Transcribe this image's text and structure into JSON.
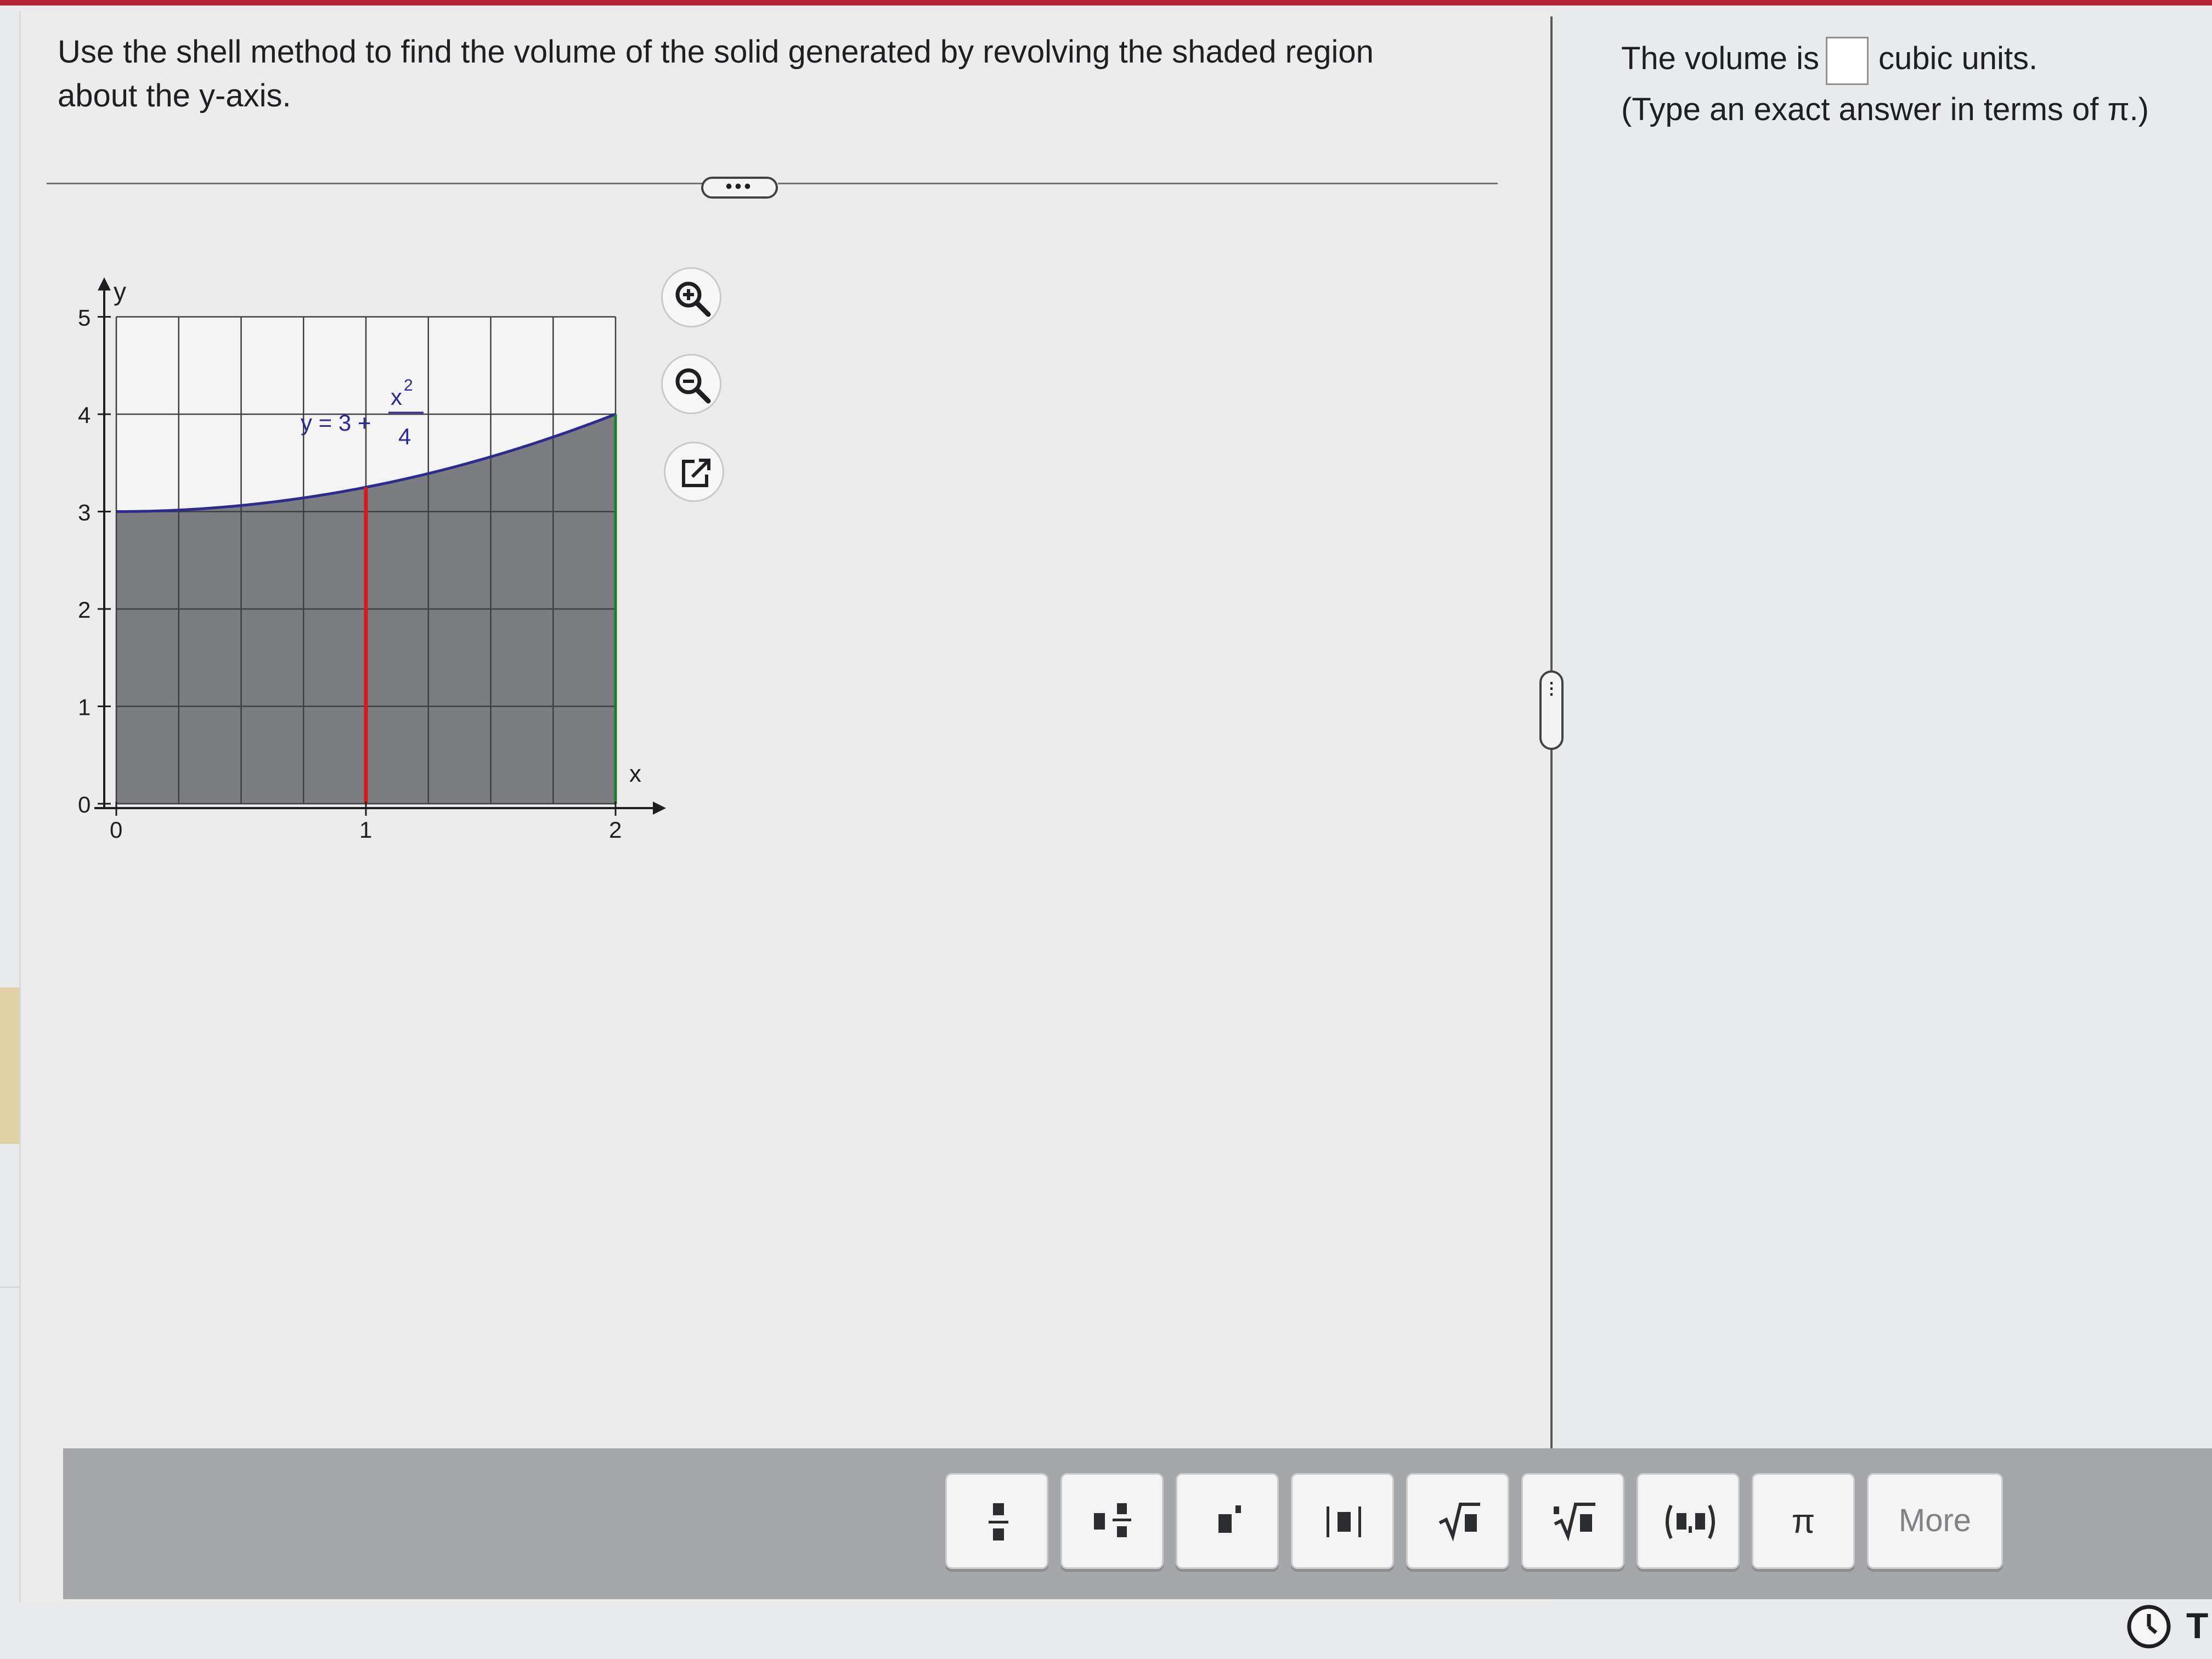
{
  "question": {
    "line1": "Use the shell method to find the volume of the solid generated by revolving the shaded region",
    "line2": "about the y-axis."
  },
  "graph": {
    "y_axis_label": "y",
    "x_axis_label": "x",
    "y_ticks": [
      "5",
      "4",
      "3",
      "2",
      "1",
      "0"
    ],
    "x_ticks": [
      "0",
      "1",
      "2"
    ],
    "curve_label_left": "y = 3 +",
    "curve_label_num": "x",
    "curve_label_exp": "2",
    "curve_label_den": "4",
    "xlim": [
      0,
      2
    ],
    "ylim": [
      0,
      5
    ],
    "curve": "y = 3 + x^2/4",
    "shell_x": 1,
    "colors": {
      "curve": "#2e2a8f",
      "shaded": "#7c7d80",
      "shell": "#d41a1a",
      "right_edge": "#1a7f2a"
    }
  },
  "tools": {
    "zoom_in": "zoom-in-icon",
    "zoom_out": "zoom-out-icon",
    "popout": "external-link-icon"
  },
  "answer": {
    "prefix": "The volume is",
    "suffix": "cubic units.",
    "hint": "(Type an exact answer in terms of π.)",
    "value": ""
  },
  "toolbar": {
    "buttons": [
      "fraction",
      "mixed-number",
      "exponent",
      "absolute-value",
      "square-root",
      "nth-root",
      "ordered-pair",
      "π",
      "More"
    ],
    "pi_label": "π",
    "more_label": "More"
  },
  "timer": {
    "label": "T"
  }
}
